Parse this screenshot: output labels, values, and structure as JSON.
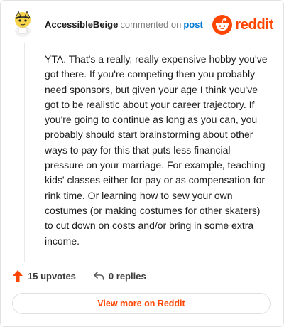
{
  "comment": {
    "username": "AccessibleBeige",
    "action_text": "commented on",
    "post_link": "post",
    "body": "YTA. That's a really, really expensive hobby you've got there. If you're competing then you probably need sponsors, but given your age I think you've got to be realistic about your career trajectory. If you're going to continue as long as you can, you probably should start brainstorming about other ways to pay for this that puts less financial pressure on your marriage. For example, teaching kids' classes either for pay or as compensation for rink time. Or learning how to sew your own costumes (or making costumes for other skaters) to cut down on costs and/or bring in some extra income.",
    "upvotes_label": "15 upvotes",
    "replies_label": "0 replies"
  },
  "brand": {
    "wordmark": "reddit",
    "icon": "reddit-snoo-icon",
    "color": "#ff4500"
  },
  "footer": {
    "view_more_label": "View more on Reddit"
  },
  "colors": {
    "upvote": "#ff4500",
    "link": "#0079d3",
    "muted": "#7c7c7c"
  }
}
